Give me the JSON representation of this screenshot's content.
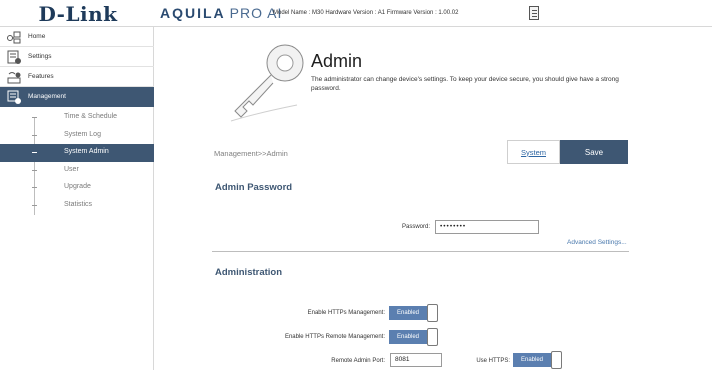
{
  "header": {
    "logo": "D-Link",
    "brand": "AQUILA",
    "brand_sub": "PRO AI",
    "model_info": "Model Name : M30   Hardware Version : A1   Firmware Version : 1.00.02"
  },
  "sidebar": {
    "items": [
      {
        "label": "Home",
        "icon": "home-network-icon"
      },
      {
        "label": "Settings",
        "icon": "settings-icon"
      },
      {
        "label": "Features",
        "icon": "features-icon"
      },
      {
        "label": "Management",
        "icon": "management-icon",
        "active": true
      }
    ],
    "subitems": [
      {
        "label": "Time & Schedule"
      },
      {
        "label": "System Log"
      },
      {
        "label": "System Admin",
        "active": true
      },
      {
        "label": "User"
      },
      {
        "label": "Upgrade"
      },
      {
        "label": "Statistics"
      }
    ]
  },
  "main": {
    "title": "Admin",
    "description": "The administrator can change device's settings. To keep your device secure, you should give have a strong password.",
    "breadcrumb": "Management>>Admin",
    "system_button": "System",
    "save_button": "Save",
    "admin_password": {
      "section_title": "Admin Password",
      "password_label": "Password:",
      "password_value": "••••••••",
      "advanced_link": "Advanced Settings..."
    },
    "administration": {
      "section_title": "Administration",
      "https_mgmt_label": "Enable HTTPs Management:",
      "https_mgmt_value": "Enabled",
      "https_remote_label": "Enable HTTPs Remote Management:",
      "https_remote_value": "Enabled",
      "remote_port_label": "Remote Admin Port:",
      "remote_port_value": "8081",
      "use_https_label": "Use HTTPS:",
      "use_https_value": "Enabled"
    }
  },
  "colors": {
    "accent": "#3e5773",
    "toggle_on": "#5b7fb0",
    "link": "#2e66a3"
  }
}
